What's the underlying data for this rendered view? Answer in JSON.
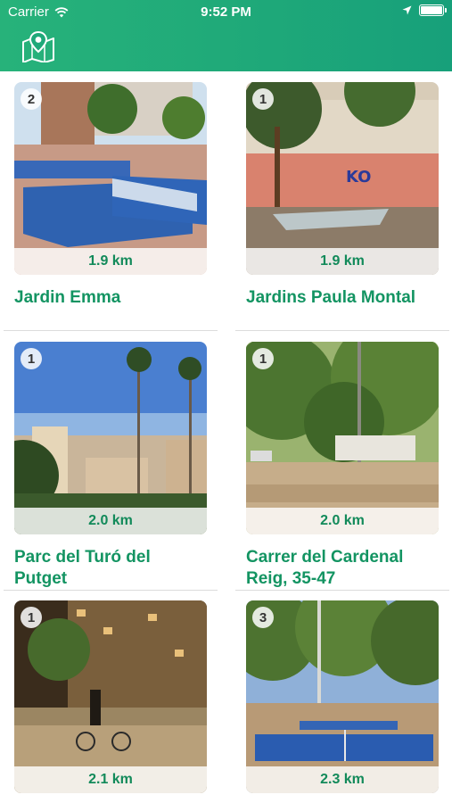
{
  "status_bar": {
    "carrier": "Carrier",
    "time": "9:52 PM"
  },
  "header": {
    "logo_icon": "map-pin-icon"
  },
  "places": [
    {
      "count": "2",
      "distance": "1.9 km",
      "name": "Jardin Emma"
    },
    {
      "count": "1",
      "distance": "1.9 km",
      "name": "Jardins Paula Montal"
    },
    {
      "count": "1",
      "distance": "2.0 km",
      "name": "Parc del Turó del Putget"
    },
    {
      "count": "1",
      "distance": "2.0 km",
      "name": "Carrer del Cardenal Reig, 35-47"
    },
    {
      "count": "1",
      "distance": "2.1 km",
      "name": ""
    },
    {
      "count": "3",
      "distance": "2.3 km",
      "name": ""
    }
  ],
  "colors": {
    "accent": "#1fa979",
    "title_text": "#139462"
  }
}
